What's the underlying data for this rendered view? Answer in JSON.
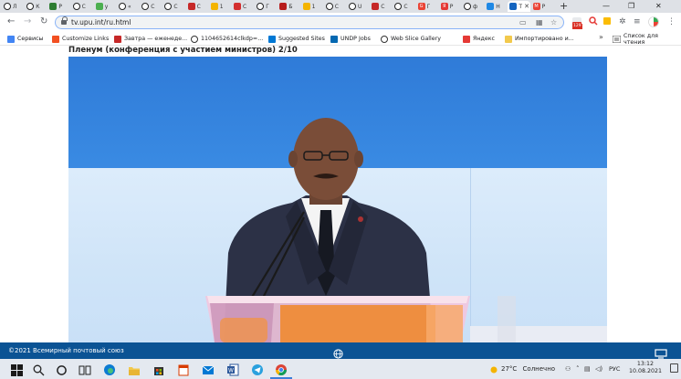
{
  "browser": {
    "tabs": [
      {
        "label": "Л",
        "fav": "ring",
        "color": "#222222"
      },
      {
        "label": "К",
        "fav": "ring",
        "color": "#222222"
      },
      {
        "label": "Р",
        "fav": "ro",
        "color": "#2e7d32"
      },
      {
        "label": "С",
        "fav": "ring",
        "color": "#222222"
      },
      {
        "label": "у",
        "fav": "dots",
        "color": "#4caf50"
      },
      {
        "label": "«",
        "fav": "ring",
        "color": "#222222"
      },
      {
        "label": "С",
        "fav": "ring",
        "color": "#222222"
      },
      {
        "label": "С",
        "fav": "ring",
        "color": "#222222"
      },
      {
        "label": "С",
        "fav": "cbi",
        "color": "#c62828"
      },
      {
        "label": "1",
        "fav": "mail",
        "color": "#f4b400"
      },
      {
        "label": "С",
        "fav": "red",
        "color": "#d32f2f"
      },
      {
        "label": "Г",
        "fav": "ring",
        "color": "#222222"
      },
      {
        "label": "Б",
        "fav": "red",
        "color": "#b71c1c"
      },
      {
        "label": "1",
        "fav": "mail",
        "color": "#f4b400"
      },
      {
        "label": "С",
        "fav": "ring",
        "color": "#222222"
      },
      {
        "label": "U",
        "fav": "ring",
        "color": "#222222"
      },
      {
        "label": "С",
        "fav": "cbi",
        "color": "#c62828"
      },
      {
        "label": "С",
        "fav": "ring",
        "color": "#222222"
      },
      {
        "label": "Г",
        "fav": "G",
        "color": "#ea4335"
      },
      {
        "label": "Р",
        "fav": "Я",
        "color": "#e53935"
      },
      {
        "label": "ф",
        "fav": "ring",
        "color": "#222222"
      },
      {
        "label": "Н",
        "fav": "un",
        "color": "#1e88e5"
      },
      {
        "label": "Т",
        "fav": "upu",
        "color": "#1565c0",
        "active": true
      },
      {
        "label": "Р",
        "fav": "M",
        "color": "#ea4335"
      }
    ],
    "new_tab": "+",
    "window_controls": {
      "minimize": "—",
      "maximize": "❐",
      "close": "✕"
    },
    "nav": {
      "back": "←",
      "forward": "→",
      "reload": "↻"
    },
    "url": "tv.upu.int/ru.html",
    "extension_badge": "129",
    "bookmarks": [
      {
        "label": "Сервисы",
        "icon": "apps-grid",
        "color": "#4285f4"
      },
      {
        "label": "Customize Links",
        "icon": "ms-tiles",
        "color": "#f25022"
      },
      {
        "label": "Завтра — еженеде...",
        "icon": "z-logo",
        "color": "#c62828"
      },
      {
        "label": "1104652614clkdp=...",
        "icon": "globe",
        "color": "#333333"
      },
      {
        "label": "Suggested Sites",
        "icon": "bing",
        "color": "#0078d4"
      },
      {
        "label": "UNDP Jobs",
        "icon": "undp",
        "color": "#0468b1"
      },
      {
        "label": "Web Slice Gallery",
        "icon": "globe",
        "color": "#333333"
      },
      {
        "label": "Яндекс",
        "icon": "yandex",
        "color": "#e53935"
      },
      {
        "label": "Импортировано и...",
        "icon": "folder",
        "color": "#f2c94c"
      }
    ],
    "bookmarks_more": "»",
    "reading_list": "Список для чтения"
  },
  "page": {
    "heading": "Пленум (конференция с участием министров) 2/10",
    "footer_copyright": "©2021 Всемирный почтовый союз"
  },
  "taskbar": {
    "weather_temp": "27°C",
    "weather_desc": "Солнечно",
    "lang": "РУС",
    "time": "13:12",
    "date": "10.08.2021"
  }
}
